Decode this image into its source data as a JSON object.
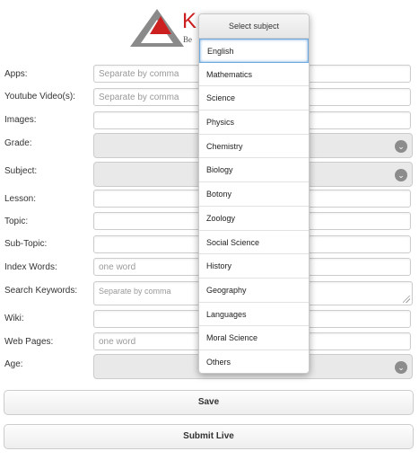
{
  "logo": {
    "text": "K",
    "subtitle": "Be"
  },
  "form": {
    "apps": {
      "label": "Apps:",
      "placeholder": "Separate by comma"
    },
    "youtube": {
      "label": "Youtube Video(s):",
      "placeholder": "Separate by comma"
    },
    "images": {
      "label": "Images:"
    },
    "grade": {
      "label": "Grade:"
    },
    "subject": {
      "label": "Subject:"
    },
    "lesson": {
      "label": "Lesson:"
    },
    "topic": {
      "label": "Topic:"
    },
    "subtopic": {
      "label": "Sub-Topic:"
    },
    "index_words": {
      "label": "Index Words:",
      "placeholder": "one word"
    },
    "search_keywords": {
      "label": "Search Keywords:",
      "placeholder": "Separate by comma"
    },
    "wiki": {
      "label": "Wiki:"
    },
    "web_pages": {
      "label": "Web Pages:",
      "placeholder": "one word"
    },
    "age": {
      "label": "Age:"
    }
  },
  "buttons": {
    "save": "Save",
    "submit_live": "Submit Live"
  },
  "dropdown": {
    "title": "Select subject",
    "options": [
      "English",
      "Mathematics",
      "Science",
      "Physics",
      "Chemistry",
      "Biology",
      "Botony",
      "Zoology",
      "Social Science",
      "History",
      "Geography",
      "Languages",
      "Moral Science",
      "Others"
    ],
    "selected_index": 0
  },
  "colors": {
    "brand_red": "#cc1f1f",
    "logo_gray": "#888888",
    "focus_blue": "#6fa8dc"
  }
}
